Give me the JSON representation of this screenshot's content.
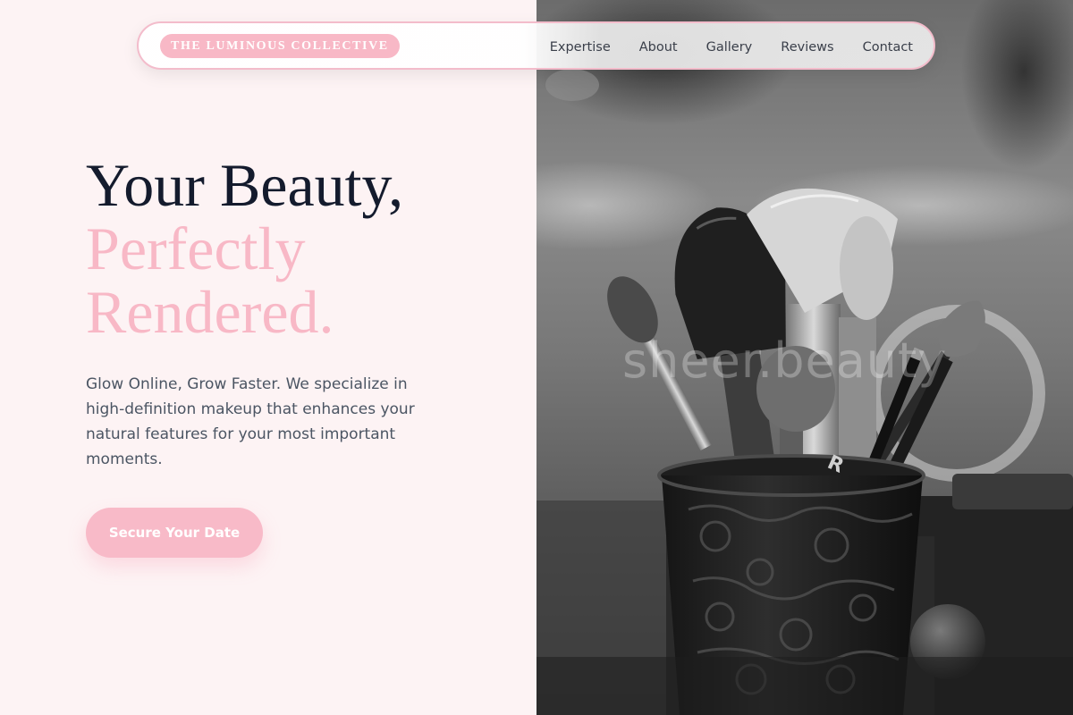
{
  "nav": {
    "brand": "THE LUMINOUS COLLECTIVE",
    "links": [
      "Expertise",
      "About",
      "Gallery",
      "Reviews",
      "Contact"
    ]
  },
  "hero": {
    "title_line1": "Your Beauty,",
    "title_line2": "Perfectly",
    "title_line3": "Rendered.",
    "description": "Glow Online, Grow Faster. We specialize in high-definition makeup that enhances your natural features for your most important moments.",
    "cta": "Secure Your Date"
  },
  "photo": {
    "watermark": "sheer.beauty",
    "jar_label": "R"
  },
  "colors": {
    "background": "#fdf3f4",
    "accent_pink": "#f8b8c6",
    "heading": "#141b2d",
    "body_text": "#4b5563"
  }
}
